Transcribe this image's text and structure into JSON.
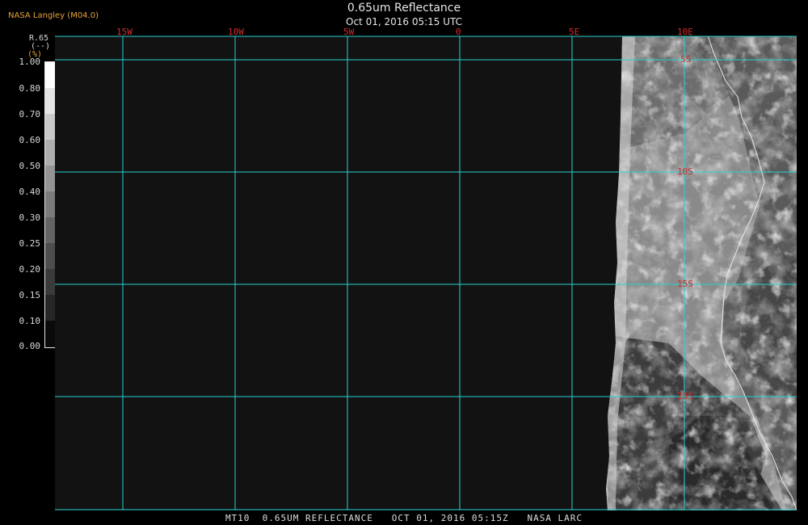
{
  "header": {
    "title": "0.65um Reflectance",
    "subtitle": "Oct 01, 2016 05:15 UTC",
    "credit": "NASA Langley (M04.0)"
  },
  "legend": {
    "label": "R.65",
    "units": "(--)",
    "unit_suffix": "(%)",
    "values": [
      "1.00",
      "0.80",
      "0.70",
      "0.60",
      "0.50",
      "0.40",
      "0.30",
      "0.25",
      "0.20",
      "0.15",
      "0.10",
      "0.00"
    ]
  },
  "map": {
    "lon_labels": [
      "15W",
      "10W",
      "5W",
      "0",
      "5E",
      "10E"
    ],
    "lat_labels": [
      "5S",
      "10S",
      "15S",
      "20S"
    ],
    "colors": {
      "grid": "#27d3d3",
      "labels": "#d42a2a",
      "coast": "#e8e8e8"
    }
  },
  "footer": {
    "text": "MT10  0.65UM REFLECTANCE   OCT 01, 2016 05:15Z   NASA LARC"
  }
}
